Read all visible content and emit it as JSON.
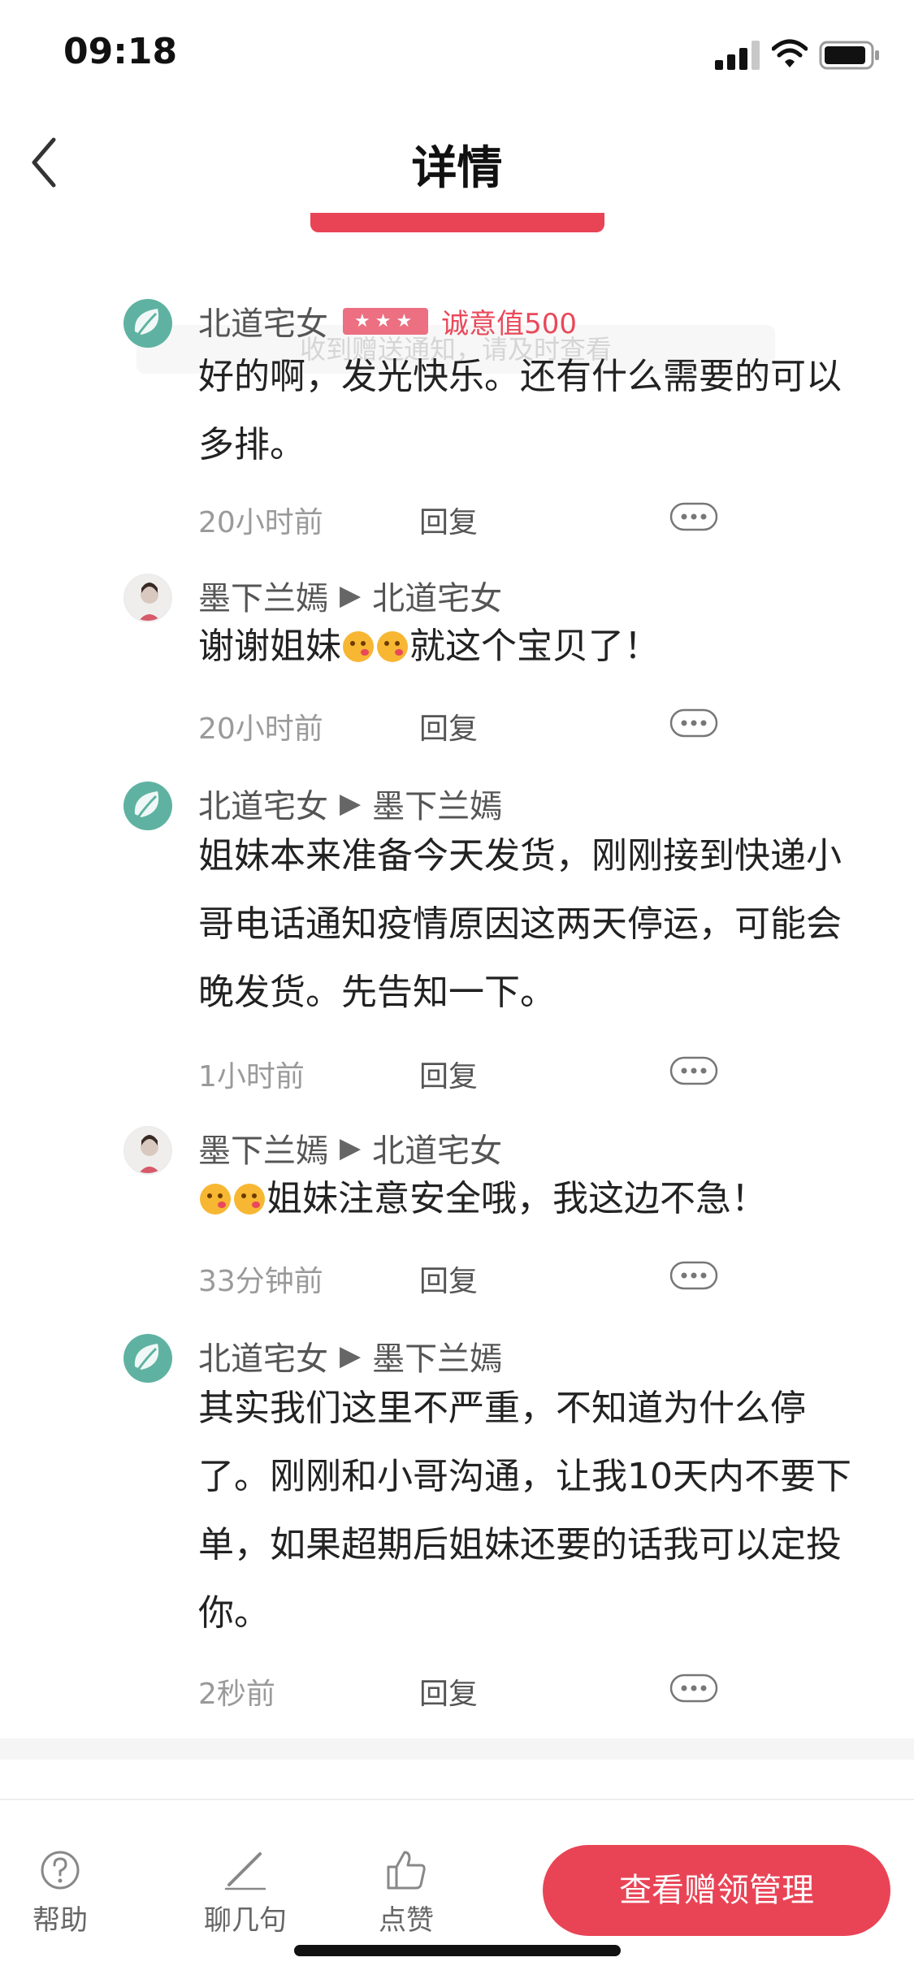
{
  "status_bar": {
    "time": "09:18"
  },
  "nav": {
    "title": "详情"
  },
  "overlay": {
    "ghost_text": "收到赠送通知，请及时查看"
  },
  "comments": [
    {
      "author": "北道宅女",
      "badge": "★★★",
      "sincerity": "诚意值500",
      "text": "好的啊，发光快乐。还有什么需要的可以多排。",
      "time": "20小时前",
      "reply": "回复"
    },
    {
      "author": "墨下兰嫣",
      "reply_to": "北道宅女",
      "text_before": "谢谢姐妹",
      "text_after": "就这个宝贝了！",
      "time": "20小时前",
      "reply": "回复"
    },
    {
      "author": "北道宅女",
      "reply_to": "墨下兰嫣",
      "text": "姐妹本来准备今天发货，刚刚接到快递小哥电话通知疫情原因这两天停运，可能会晚发货。先告知一下。",
      "time": "1小时前",
      "reply": "回复"
    },
    {
      "author": "墨下兰嫣",
      "reply_to": "北道宅女",
      "text_after": "姐妹注意安全哦，我这边不急！",
      "time": "33分钟前",
      "reply": "回复"
    },
    {
      "author": "北道宅女",
      "reply_to": "墨下兰嫣",
      "text": "其实我们这里不严重，不知道为什么停了。刚刚和小哥沟通，让我10天内不要下单，如果超期后姐妹还要的话我可以定投你。",
      "time": "2秒前",
      "reply": "回复"
    }
  ],
  "bottom_bar": {
    "help_label": "帮助",
    "chat_label": "聊几句",
    "like_label": "点赞",
    "cta_label": "查看赠领管理"
  },
  "colors": {
    "accent": "#e94456",
    "badge": "#ec6f82",
    "meta_gray": "#9a9a9a",
    "leaf_avatar": "#5fb2a1"
  },
  "icons": [
    "back-icon",
    "signal-icon",
    "wifi-icon",
    "battery-icon",
    "leaf-avatar",
    "person-avatar",
    "more-icon",
    "help-icon",
    "pen-icon",
    "thumb-up-icon",
    "blush-emoji"
  ]
}
